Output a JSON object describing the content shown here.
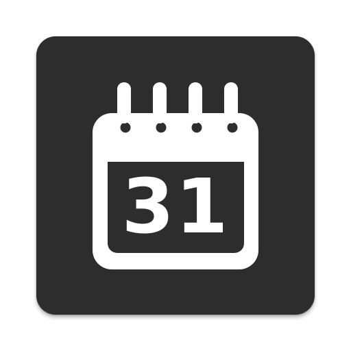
{
  "icon": {
    "name": "calendar-icon",
    "date_number": "31"
  },
  "colors": {
    "tile_background": "#2d2d2d",
    "glyph": "#ffffff"
  }
}
